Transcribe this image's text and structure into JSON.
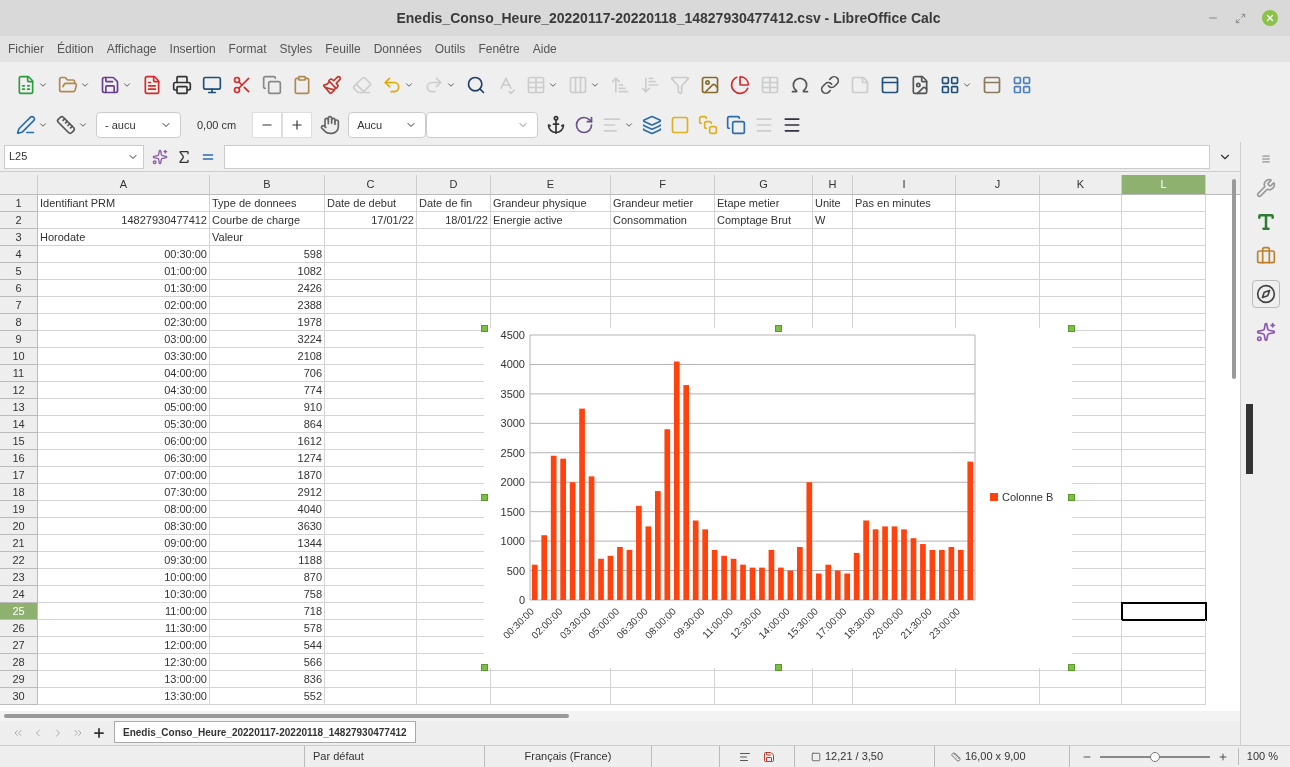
{
  "window": {
    "title": "Enedis_Conso_Heure_20220117-20220118_14827930477412.csv - LibreOffice Calc"
  },
  "menu": [
    "Fichier",
    "Édition",
    "Affichage",
    "Insertion",
    "Format",
    "Styles",
    "Feuille",
    "Données",
    "Outils",
    "Fenêtre",
    "Aide"
  ],
  "drawing_toolbar": {
    "line_style": "- aucu",
    "line_width": "0,00 cm",
    "area_style": "Aucu"
  },
  "formula_bar": {
    "name_box": "L25"
  },
  "sheet": {
    "columns": [
      {
        "label": "A",
        "selected": false
      },
      {
        "label": "B",
        "selected": false
      },
      {
        "label": "C",
        "selected": false
      },
      {
        "label": "D",
        "selected": false
      },
      {
        "label": "E",
        "selected": false
      },
      {
        "label": "F",
        "selected": false
      },
      {
        "label": "G",
        "selected": false
      },
      {
        "label": "H",
        "selected": false
      },
      {
        "label": "I",
        "selected": false
      },
      {
        "label": "J",
        "selected": false
      },
      {
        "label": "K",
        "selected": false
      },
      {
        "label": "L",
        "selected": true
      }
    ],
    "rows": [
      {
        "number": "1",
        "selected": false,
        "cells": [
          {
            "kind": "text",
            "text": "Identifiant PRM"
          },
          {
            "kind": "text",
            "text": "Type de donnees"
          },
          {
            "kind": "text",
            "text": "Date de debut"
          },
          {
            "kind": "text",
            "text": "Date de fin"
          },
          {
            "kind": "text",
            "text": "Grandeur physique"
          },
          {
            "kind": "text",
            "text": "Grandeur metier"
          },
          {
            "kind": "text",
            "text": "Etape metier"
          },
          {
            "kind": "text",
            "text": "Unite"
          },
          {
            "kind": "text",
            "text": "Pas en minutes"
          }
        ]
      },
      {
        "number": "2",
        "selected": false,
        "cells": [
          {
            "kind": "number",
            "text": "14827930477412"
          },
          {
            "kind": "text",
            "text": "Courbe de charge"
          },
          {
            "kind": "number",
            "text": "17/01/22"
          },
          {
            "kind": "number",
            "text": "18/01/22"
          },
          {
            "kind": "text",
            "text": "Energie active"
          },
          {
            "kind": "text",
            "text": "Consommation"
          },
          {
            "kind": "text",
            "text": "Comptage Brut"
          },
          {
            "kind": "text",
            "text": "W"
          }
        ]
      },
      {
        "number": "3",
        "selected": false,
        "cells": [
          {
            "kind": "text",
            "text": "Horodate"
          },
          {
            "kind": "text",
            "text": "Valeur"
          }
        ]
      },
      {
        "number": "4",
        "selected": false,
        "cells": [
          {
            "kind": "number",
            "text": "00:30:00"
          },
          {
            "kind": "number",
            "text": "598"
          }
        ]
      },
      {
        "number": "5",
        "selected": false,
        "cells": [
          {
            "kind": "number",
            "text": "01:00:00"
          },
          {
            "kind": "number",
            "text": "1082"
          }
        ]
      },
      {
        "number": "6",
        "selected": false,
        "cells": [
          {
            "kind": "number",
            "text": "01:30:00"
          },
          {
            "kind": "number",
            "text": "2426"
          }
        ]
      },
      {
        "number": "7",
        "selected": false,
        "cells": [
          {
            "kind": "number",
            "text": "02:00:00"
          },
          {
            "kind": "number",
            "text": "2388"
          }
        ]
      },
      {
        "number": "8",
        "selected": false,
        "cells": [
          {
            "kind": "number",
            "text": "02:30:00"
          },
          {
            "kind": "number",
            "text": "1978"
          }
        ]
      },
      {
        "number": "9",
        "selected": false,
        "cells": [
          {
            "kind": "number",
            "text": "03:00:00"
          },
          {
            "kind": "number",
            "text": "3224"
          }
        ]
      },
      {
        "number": "10",
        "selected": false,
        "cells": [
          {
            "kind": "number",
            "text": "03:30:00"
          },
          {
            "kind": "number",
            "text": "2108"
          }
        ]
      },
      {
        "number": "11",
        "selected": false,
        "cells": [
          {
            "kind": "number",
            "text": "04:00:00"
          },
          {
            "kind": "number",
            "text": "706"
          }
        ]
      },
      {
        "number": "12",
        "selected": false,
        "cells": [
          {
            "kind": "number",
            "text": "04:30:00"
          },
          {
            "kind": "number",
            "text": "774"
          }
        ]
      },
      {
        "number": "13",
        "selected": false,
        "cells": [
          {
            "kind": "number",
            "text": "05:00:00"
          },
          {
            "kind": "number",
            "text": "910"
          }
        ]
      },
      {
        "number": "14",
        "selected": false,
        "cells": [
          {
            "kind": "number",
            "text": "05:30:00"
          },
          {
            "kind": "number",
            "text": "864"
          }
        ]
      },
      {
        "number": "15",
        "selected": false,
        "cells": [
          {
            "kind": "number",
            "text": "06:00:00"
          },
          {
            "kind": "number",
            "text": "1612"
          }
        ]
      },
      {
        "number": "16",
        "selected": false,
        "cells": [
          {
            "kind": "number",
            "text": "06:30:00"
          },
          {
            "kind": "number",
            "text": "1274"
          }
        ]
      },
      {
        "number": "17",
        "selected": false,
        "cells": [
          {
            "kind": "number",
            "text": "07:00:00"
          },
          {
            "kind": "number",
            "text": "1870"
          }
        ]
      },
      {
        "number": "18",
        "selected": false,
        "cells": [
          {
            "kind": "number",
            "text": "07:30:00"
          },
          {
            "kind": "number",
            "text": "2912"
          }
        ]
      },
      {
        "number": "19",
        "selected": false,
        "cells": [
          {
            "kind": "number",
            "text": "08:00:00"
          },
          {
            "kind": "number",
            "text": "4040"
          }
        ]
      },
      {
        "number": "20",
        "selected": false,
        "cells": [
          {
            "kind": "number",
            "text": "08:30:00"
          },
          {
            "kind": "number",
            "text": "3630"
          }
        ]
      },
      {
        "number": "21",
        "selected": false,
        "cells": [
          {
            "kind": "number",
            "text": "09:00:00"
          },
          {
            "kind": "number",
            "text": "1344"
          }
        ]
      },
      {
        "number": "22",
        "selected": false,
        "cells": [
          {
            "kind": "number",
            "text": "09:30:00"
          },
          {
            "kind": "number",
            "text": "1188"
          }
        ]
      },
      {
        "number": "23",
        "selected": false,
        "cells": [
          {
            "kind": "number",
            "text": "10:00:00"
          },
          {
            "kind": "number",
            "text": "870"
          }
        ]
      },
      {
        "number": "24",
        "selected": false,
        "cells": [
          {
            "kind": "number",
            "text": "10:30:00"
          },
          {
            "kind": "number",
            "text": "758"
          }
        ]
      },
      {
        "number": "25",
        "selected": true,
        "cells": [
          {
            "kind": "number",
            "text": "11:00:00"
          },
          {
            "kind": "number",
            "text": "718"
          }
        ]
      },
      {
        "number": "26",
        "selected": false,
        "cells": [
          {
            "kind": "number",
            "text": "11:30:00"
          },
          {
            "kind": "number",
            "text": "578"
          }
        ]
      },
      {
        "number": "27",
        "selected": false,
        "cells": [
          {
            "kind": "number",
            "text": "12:00:00"
          },
          {
            "kind": "number",
            "text": "544"
          }
        ]
      },
      {
        "number": "28",
        "selected": false,
        "cells": [
          {
            "kind": "number",
            "text": "12:30:00"
          },
          {
            "kind": "number",
            "text": "566"
          }
        ]
      },
      {
        "number": "29",
        "selected": false,
        "cells": [
          {
            "kind": "number",
            "text": "13:00:00"
          },
          {
            "kind": "number",
            "text": "836"
          }
        ]
      },
      {
        "number": "30",
        "selected": false,
        "cells": [
          {
            "kind": "number",
            "text": "13:30:00"
          },
          {
            "kind": "number",
            "text": "552"
          }
        ]
      }
    ],
    "chart": {
      "chart_data": {
        "type": "bar",
        "grid": true,
        "categories": [
          "00:30:00",
          null,
          null,
          "02:00:00",
          null,
          null,
          "03:30:00",
          null,
          null,
          "05:00:00",
          null,
          null,
          "06:30:00",
          null,
          null,
          "08:00:00",
          null,
          null,
          "09:30:00",
          null,
          null,
          "11:00:00",
          null,
          null,
          "12:30:00",
          null,
          null,
          "14:00:00",
          null,
          null,
          "15:30:00",
          null,
          null,
          "17:00:00",
          null,
          null,
          "18:30:00",
          null,
          null,
          "20:00:00",
          null,
          null,
          "21:30:00",
          null,
          null,
          "23:00:00",
          null
        ],
        "series": [
          {
            "name": "Colonne B",
            "color": "#ff420e",
            "values": [
              600,
              1100,
              2450,
              2400,
              2000,
              3250,
              2100,
              700,
              750,
              900,
              850,
              1600,
              1250,
              1850,
              2900,
              4050,
              3650,
              1350,
              1200,
              850,
              750,
              700,
              600,
              550,
              550,
              850,
              550,
              500,
              900,
              2000,
              450,
              600,
              500,
              450,
              800,
              1350,
              1200,
              1250,
              1250,
              1200,
              1050,
              950,
              850,
              850,
              900,
              850,
              2350
            ]
          }
        ],
        "ylim": [
          0,
          4500
        ],
        "yticks": [
          0,
          500,
          1000,
          1500,
          2000,
          2500,
          3000,
          3500,
          4000,
          4500
        ]
      }
    }
  },
  "sheet_tabs": [
    {
      "label": "Enedis_Conso_Heure_20220117-20220118_14827930477412",
      "selected": true
    }
  ],
  "status_bar": {
    "page_style": "Par défaut",
    "language": "Français (France)",
    "position": "12,21 / 3,50",
    "size": "16,00 x 9,00",
    "zoom": {
      "level": 0.5,
      "reading": "100 %"
    }
  }
}
